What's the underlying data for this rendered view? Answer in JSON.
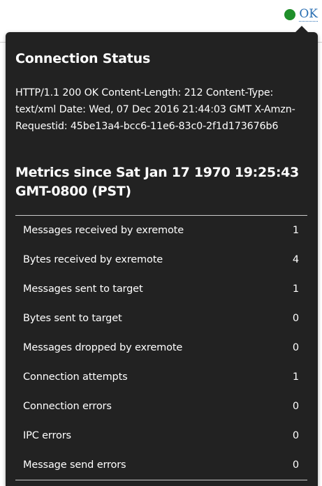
{
  "status": {
    "indicator_color": "#1f8f2a",
    "link_label": "OK"
  },
  "popover": {
    "title": "Connection Status",
    "response_text": "HTTP/1.1 200 OK Content-Length: 212 Content-Type: text/xml Date: Wed, 07 Dec 2016 21:44:03 GMT X-Amzn-Requestid: 45be13a4-bcc6-11e6-83c0-2f1d173676b6",
    "metrics_heading": "Metrics since Sat Jan 17 1970 19:25:43 GMT-0800 (PST)",
    "metrics": [
      {
        "label": "Messages received by exremote",
        "value": "1"
      },
      {
        "label": "Bytes received by exremote",
        "value": "4"
      },
      {
        "label": "Messages sent to target",
        "value": "1"
      },
      {
        "label": "Bytes sent to target",
        "value": "0"
      },
      {
        "label": "Messages dropped by exremote",
        "value": "0"
      },
      {
        "label": "Connection attempts",
        "value": "1"
      },
      {
        "label": "Connection errors",
        "value": "0"
      },
      {
        "label": "IPC errors",
        "value": "0"
      },
      {
        "label": "Message send errors",
        "value": "0"
      }
    ]
  }
}
